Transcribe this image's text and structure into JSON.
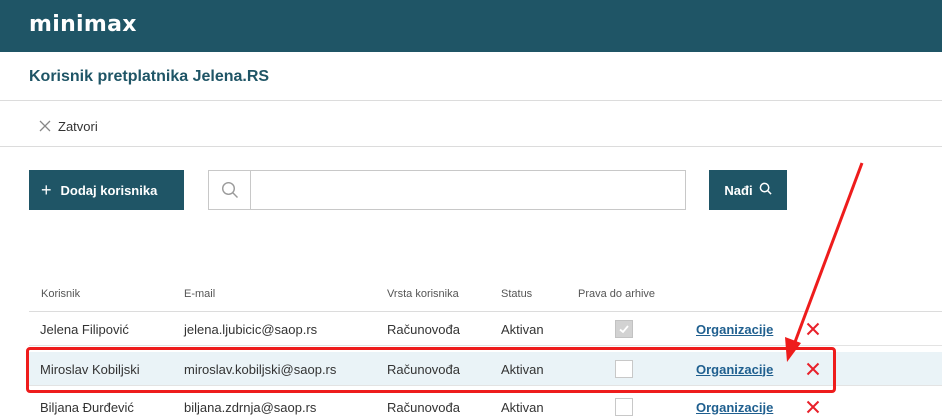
{
  "app": {
    "logo": "minimax"
  },
  "page": {
    "title": "Korisnik pretplatnika Jelena.RS"
  },
  "toolbar": {
    "close_label": "Zatvori"
  },
  "actions": {
    "add_user_label": "Dodaj korisnika",
    "find_label": "Nađi",
    "search_value": "",
    "search_placeholder": ""
  },
  "table": {
    "headers": {
      "user": "Korisnik",
      "email": "E-mail",
      "type": "Vrsta korisnika",
      "status": "Status",
      "archive": "Prava do arhive"
    },
    "rows": [
      {
        "name": "Jelena Filipović",
        "email": "jelena.ljubicic@saop.rs",
        "type": "Računovođa",
        "status": "Aktivan",
        "archive_checked": true,
        "link": "Organizacije"
      },
      {
        "name": "Miroslav Kobiljski",
        "email": "miroslav.kobiljski@saop.rs",
        "type": "Računovođa",
        "status": "Aktivan",
        "archive_checked": false,
        "link": "Organizacije"
      },
      {
        "name": "Biljana Đurđević",
        "email": "biljana.zdrnja@saop.rs",
        "type": "Računovođa",
        "status": "Aktivan",
        "archive_checked": false,
        "link": "Organizacije"
      }
    ]
  },
  "colors": {
    "brand": "#1f5566",
    "link": "#1f5f8f",
    "delete": "#e8202a",
    "annotation": "#ee1c1c",
    "row_highlight": "#eaf3f7"
  },
  "icons": {
    "close": "close-icon",
    "add": "plus-icon",
    "search": "search-icon",
    "find": "search-icon",
    "delete": "delete-x-icon",
    "checkbox_checked": "check-icon"
  }
}
